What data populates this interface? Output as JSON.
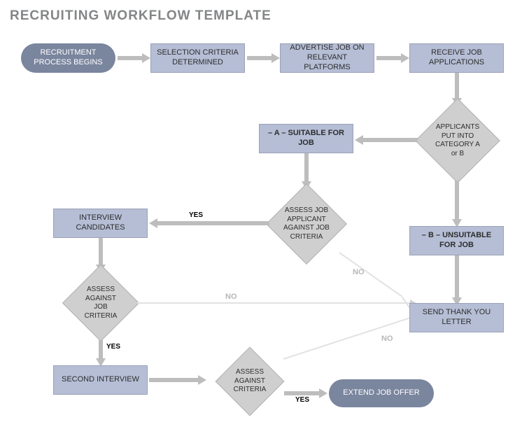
{
  "title": "RECRUITING WORKFLOW TEMPLATE",
  "nodes": {
    "start": "RECRUITMENT PROCESS BEGINS",
    "criteria": "SELECTION CRITERIA DETERMINED",
    "advertise": "ADVERTISE JOB ON RELEVANT PLATFORMS",
    "receive": "RECEIVE JOB APPLICATIONS",
    "categorize": "APPLICANTS PUT INTO CATEGORY A or B",
    "catA": "– A – SUITABLE FOR JOB",
    "catB": "– B – UNSUITABLE FOR JOB",
    "assessA": "ASSESS JOB APPLICANT AGAINST JOB CRITERIA",
    "interview": "INTERVIEW CANDIDATES",
    "assess2": "ASSESS AGAINST JOB CRITERIA",
    "second": "SECOND INTERVIEW",
    "assess3": "ASSESS AGAINST CRITERIA",
    "offer": "EXTEND JOB OFFER",
    "thankyou": "SEND THANK YOU LETTER"
  },
  "labels": {
    "yes": "YES",
    "no": "NO"
  }
}
